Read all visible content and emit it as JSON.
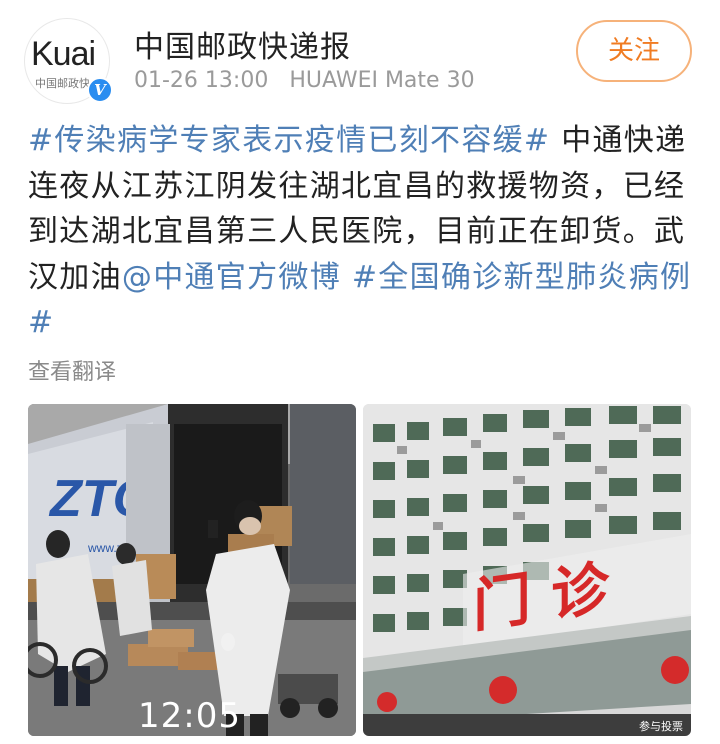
{
  "author": {
    "avatar_text": "Kuai",
    "avatar_subtitle": "中国邮政快",
    "verified_mark": "V",
    "name": "中国邮政快递报",
    "timestamp": "01-26 13:00",
    "device": "HUAWEI Mate 30"
  },
  "follow_label": "关注",
  "post": {
    "tag1": "#传染病学专家表示疫情已刻不容缓#",
    "text1": " 中通快递连夜从江苏江阴发往湖北宜昌的救援物资，已经到达湖北宜昌第三人民医院，目前正在卸货。武汉加油",
    "mention": "@中通官方微博",
    "space": " ",
    "tag2": "#全国确诊新型肺炎病例#"
  },
  "translate_label": "查看翻译",
  "photos": {
    "left": {
      "truck_logo": "ZTO",
      "truck_url": "www.zto.com",
      "overlay_time": "12:05"
    },
    "right": {
      "sign_text": "门 诊",
      "watermark": "参与投票"
    }
  },
  "colors": {
    "link": "#4f7fb6",
    "follow_text": "#f07c23",
    "follow_border": "#f6b27a",
    "verified": "#2a8df0"
  }
}
